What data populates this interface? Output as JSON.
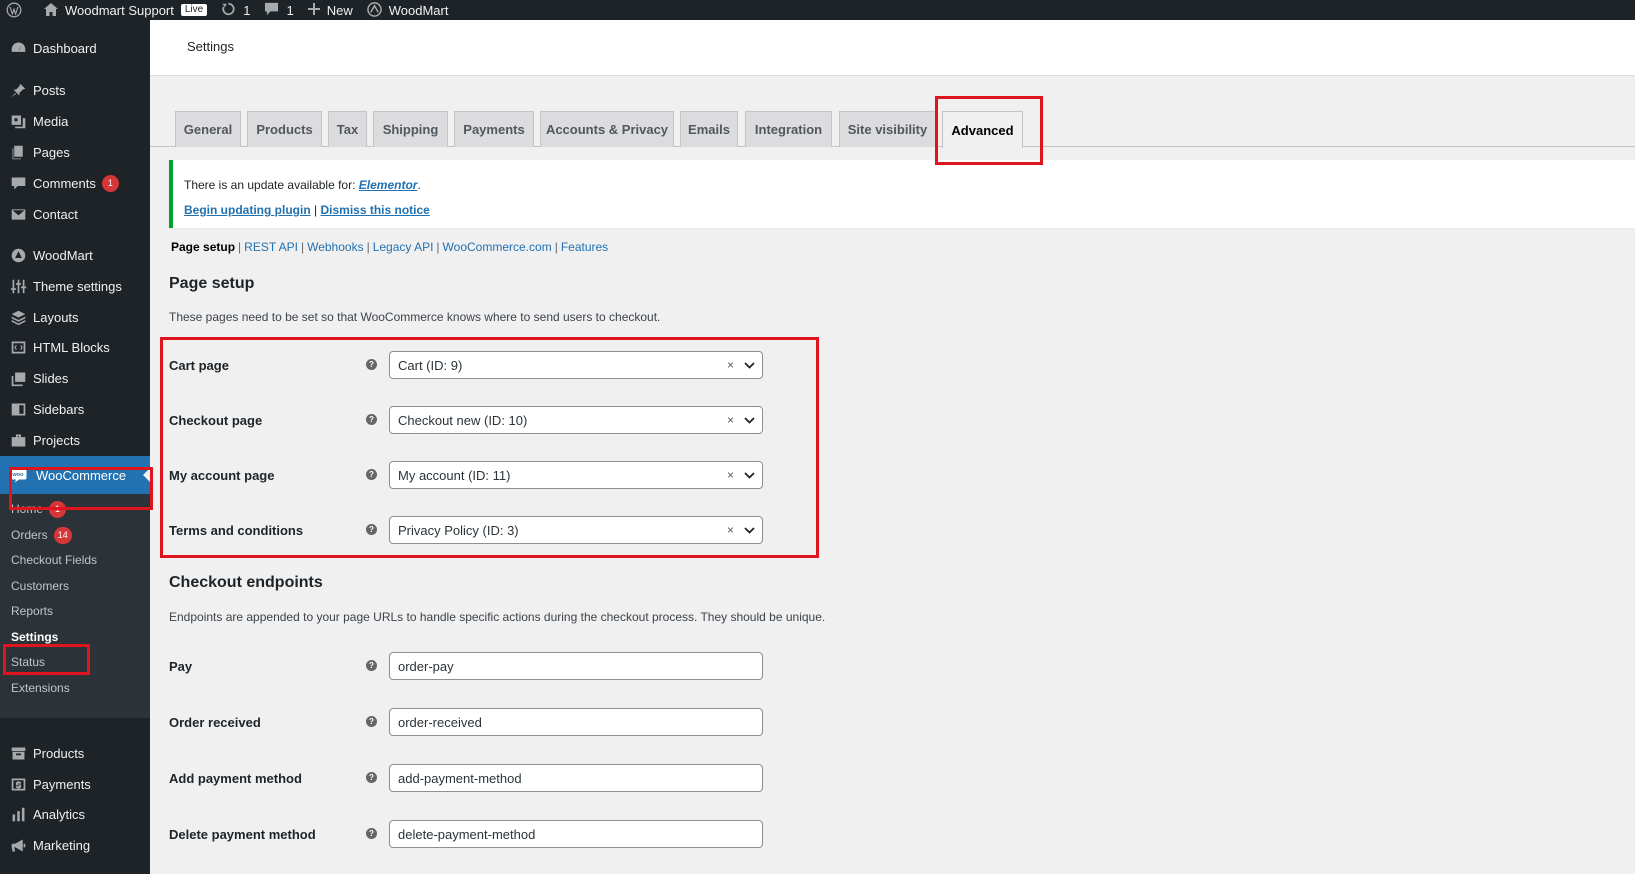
{
  "admin_bar": {
    "site_name": "Woodmart Support",
    "live_badge": "Live",
    "updates_count": "1",
    "comments_count": "1",
    "new_label": "New",
    "woodmart_label": "WoodMart"
  },
  "sidebar": {
    "items": [
      {
        "label": "Dashboard",
        "icon": "dashboard-icon"
      },
      {
        "label": "Posts",
        "icon": "pin-icon"
      },
      {
        "label": "Media",
        "icon": "media-icon"
      },
      {
        "label": "Pages",
        "icon": "pages-icon"
      },
      {
        "label": "Comments",
        "icon": "comment-icon",
        "badge": "1"
      },
      {
        "label": "Contact",
        "icon": "mail-icon"
      },
      {
        "label": "WoodMart",
        "icon": "woodmart-icon"
      },
      {
        "label": "Theme settings",
        "icon": "sliders-icon"
      },
      {
        "label": "Layouts",
        "icon": "layers-icon"
      },
      {
        "label": "HTML Blocks",
        "icon": "code-icon"
      },
      {
        "label": "Slides",
        "icon": "slides-icon"
      },
      {
        "label": "Sidebars",
        "icon": "sidebar-icon"
      },
      {
        "label": "Projects",
        "icon": "briefcase-icon"
      }
    ],
    "woocommerce": {
      "label": "WooCommerce",
      "icon": "woo-icon"
    },
    "submenu": [
      {
        "label": "Home",
        "badge": "1"
      },
      {
        "label": "Orders",
        "badge": "14"
      },
      {
        "label": "Checkout Fields"
      },
      {
        "label": "Customers"
      },
      {
        "label": "Reports"
      },
      {
        "label": "Settings",
        "current": true
      },
      {
        "label": "Status"
      },
      {
        "label": "Extensions"
      }
    ],
    "bottom_items": [
      {
        "label": "Products",
        "icon": "archive-icon"
      },
      {
        "label": "Payments",
        "icon": "dollar-icon"
      },
      {
        "label": "Analytics",
        "icon": "bar-chart-icon"
      },
      {
        "label": "Marketing",
        "icon": "megaphone-icon"
      }
    ]
  },
  "header": {
    "title": "Settings"
  },
  "tabs": [
    "General",
    "Products",
    "Tax",
    "Shipping",
    "Payments",
    "Accounts & Privacy",
    "Emails",
    "Integration",
    "Site visibility",
    "Advanced"
  ],
  "active_tab": "Advanced",
  "notice": {
    "text": "There is an update available for:",
    "plugin": "Elementor",
    "period": ".",
    "update_link": "Begin updating plugin",
    "separator": "|",
    "dismiss_link": "Dismiss this notice"
  },
  "subnav": {
    "current": "Page setup",
    "links": [
      "REST API",
      "Webhooks",
      "Legacy API",
      "WooCommerce.com",
      "Features"
    ]
  },
  "page_setup": {
    "title": "Page setup",
    "description": "These pages need to be set so that WooCommerce knows where to send users to checkout.",
    "rows": [
      {
        "label": "Cart page",
        "value": "Cart (ID: 9)"
      },
      {
        "label": "Checkout page",
        "value": "Checkout new (ID: 10)"
      },
      {
        "label": "My account page",
        "value": "My account (ID: 11)"
      },
      {
        "label": "Terms and conditions",
        "value": "Privacy Policy (ID: 3)"
      }
    ]
  },
  "checkout_endpoints": {
    "title": "Checkout endpoints",
    "description": "Endpoints are appended to your page URLs to handle specific actions during the checkout process. They should be unique.",
    "rows": [
      {
        "label": "Pay",
        "value": "order-pay"
      },
      {
        "label": "Order received",
        "value": "order-received"
      },
      {
        "label": "Add payment method",
        "value": "add-payment-method"
      },
      {
        "label": "Delete payment method",
        "value": "delete-payment-method"
      }
    ]
  },
  "glyphs": {
    "help": "?",
    "clear": "×"
  },
  "colors": {
    "sidebar_bg": "#1d2327",
    "current_menu_bg": "#2271b1",
    "link": "#2271b1",
    "highlight": "#e0141e",
    "notice_border": "#00a32a",
    "badge": "#d63638"
  }
}
